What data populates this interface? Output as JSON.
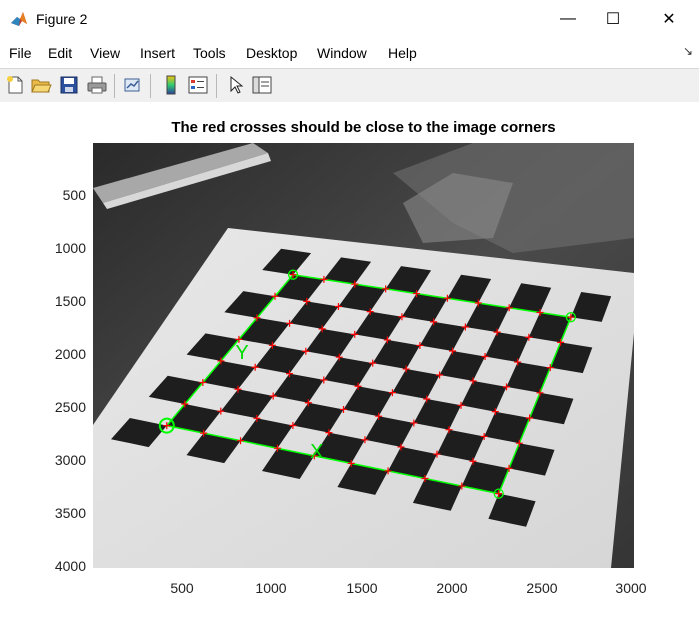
{
  "window": {
    "title": "Figure 2",
    "minimize_glyph": "—",
    "maximize_glyph": "☐",
    "close_glyph": "✕"
  },
  "menu": {
    "items": [
      "File",
      "Edit",
      "View",
      "Insert",
      "Tools",
      "Desktop",
      "Window",
      "Help"
    ],
    "dock_glyph": "↘"
  },
  "toolbar": {
    "icons": [
      "new-figure-icon",
      "open-file-icon",
      "save-icon",
      "print-icon",
      "link-plot-icon",
      "colorbar-icon",
      "legend-icon",
      "pointer-icon",
      "property-editor-icon"
    ]
  },
  "figure": {
    "title": "The red crosses should be close to the image corners",
    "y_ticks": [
      "500",
      "1000",
      "1500",
      "2000",
      "2500",
      "3000",
      "3500",
      "4000"
    ],
    "x_ticks": [
      "500",
      "1000",
      "1500",
      "2000",
      "2500",
      "3000"
    ],
    "axis_marker_x": "X",
    "axis_marker_y": "Y",
    "x_range": [
      1,
      3000
    ],
    "y_range": [
      1,
      4000
    ],
    "grid_outline_color": "#00ff00",
    "cross_color": "#ff0000"
  },
  "chart_data": {
    "type": "scatter",
    "title": "The red crosses should be close to the image corners",
    "xlim": [
      1,
      3000
    ],
    "ylim": [
      1,
      4000
    ],
    "y_reversed": true,
    "grid_corners": [
      {
        "x": 1110,
        "y": 1240
      },
      {
        "x": 2650,
        "y": 1640
      },
      {
        "x": 2250,
        "y": 3300
      },
      {
        "x": 410,
        "y": 2660
      }
    ],
    "origin_corner": {
      "x": 410,
      "y": 2660
    },
    "grid_rows": 8,
    "grid_cols": 10
  }
}
